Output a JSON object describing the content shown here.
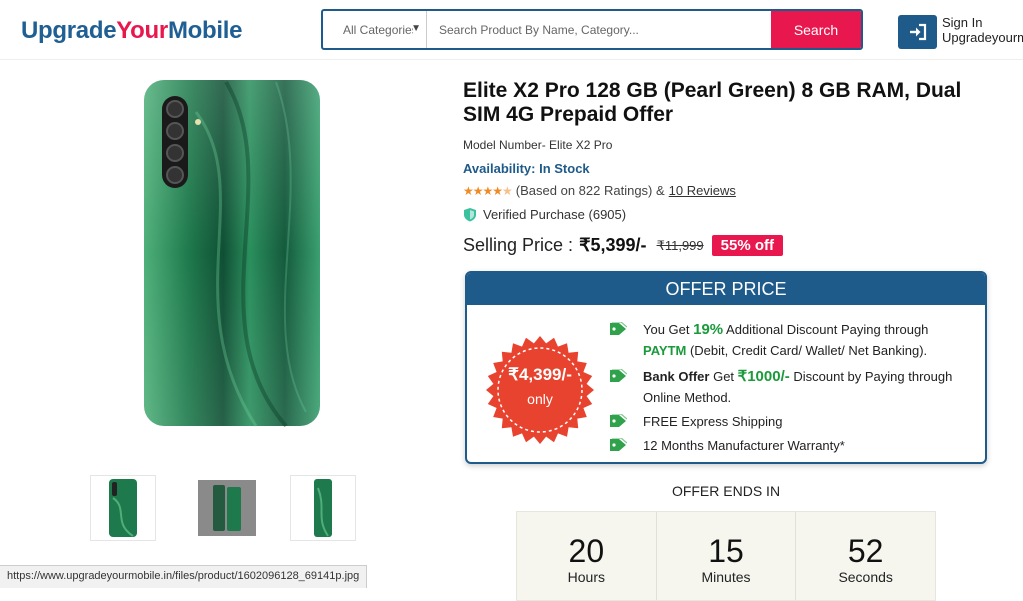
{
  "header": {
    "logo_parts": [
      "Upgrade",
      "Your",
      "Mobile"
    ],
    "category_select": "All Categories",
    "search_placeholder": "Search Product By Name, Category...",
    "search_button": "Search",
    "signin_line1": "Sign In",
    "signin_line2": "Upgradeyourmobile"
  },
  "product": {
    "title": "Elite X2 Pro 128 GB (Pearl Green) 8 GB RAM, Dual SIM 4G Prepaid Offer",
    "model": "Model Number- Elite X2 Pro",
    "availability": "Availability: In Stock",
    "rating_stars": 4.5,
    "rating_text": "(Based on 822 Ratings) &",
    "reviews_link": "10 Reviews",
    "verified": "Verified Purchase (6905)",
    "price_label": "Selling Price :",
    "price": "₹5,399/-",
    "mrp": "₹11,999",
    "discount": "55% off"
  },
  "offer": {
    "heading": "OFFER PRICE",
    "badge_price": "₹4,399/-",
    "badge_only": "only",
    "items": [
      {
        "pre": "You Get ",
        "hl": "19%",
        "mid": " Additional Discount Paying through ",
        "hl2": "PAYTM",
        "post": " (Debit, Credit Card/ Wallet/ Net Banking)."
      },
      {
        "bold": "Bank Offer",
        "pre": " Get ",
        "hl": "₹1000/-",
        "post": " Discount by Paying through Online Method."
      },
      {
        "text": "FREE Express Shipping"
      },
      {
        "text": "12 Months Manufacturer Warranty*"
      }
    ]
  },
  "countdown": {
    "title": "OFFER ENDS IN",
    "cells": [
      {
        "num": "20",
        "unit": "Hours"
      },
      {
        "num": "15",
        "unit": "Minutes"
      },
      {
        "num": "52",
        "unit": "Seconds"
      }
    ]
  },
  "statusbar": "https://www.upgradeyourmobile.in/files/product/1602096128_69141p.jpg",
  "colors": {
    "brand_blue": "#1e5a8a",
    "brand_red": "#e8184f",
    "offer_green": "#1a9a3a",
    "phone_green": "#2e8a55"
  }
}
